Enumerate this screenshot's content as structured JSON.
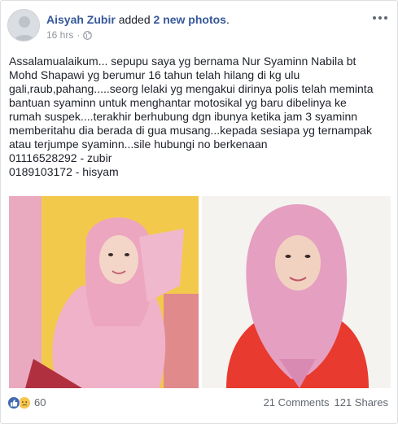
{
  "post": {
    "author": "Aisyah Zubir",
    "action_prefix": "added",
    "action_highlight": "2 new photos",
    "action_suffix": ".",
    "time": "16 hrs",
    "separator": "·",
    "text_lines": [
      "Assalamualaikum... sepupu saya yg bernama Nur Syaminn Nabila bt",
      "Mohd Shapawi yg berumur 16 tahun telah hilang di kg ulu",
      "gali,raub,pahang.....seorg lelaki yg mengakui dirinya polis telah meminta",
      "bantuan syaminn untuk menghantar motosikal yg baru dibelinya ke",
      "rumah suspek....terakhir berhubung dgn ibunya ketika jam 3 syaminn",
      "memberitahu dia berada di gua musang...kepada sesiapa yg ternampak",
      "atau terjumpe syaminn...sile hubungi no berkenaan",
      "01116528292 - zubir",
      "0189103172 - hisyam"
    ]
  },
  "footer": {
    "reaction_count": "60",
    "comments": "21 Comments",
    "shares": "121 Shares"
  },
  "icons": {
    "globe": "globe-icon",
    "more": "more-options-icon",
    "like": "like-reaction-icon",
    "sad": "sad-reaction-icon"
  },
  "colors": {
    "name_link": "#365899",
    "meta_gray": "#90949c",
    "like_blue": "#4267b2",
    "sad_yellow": "#f7c548"
  }
}
